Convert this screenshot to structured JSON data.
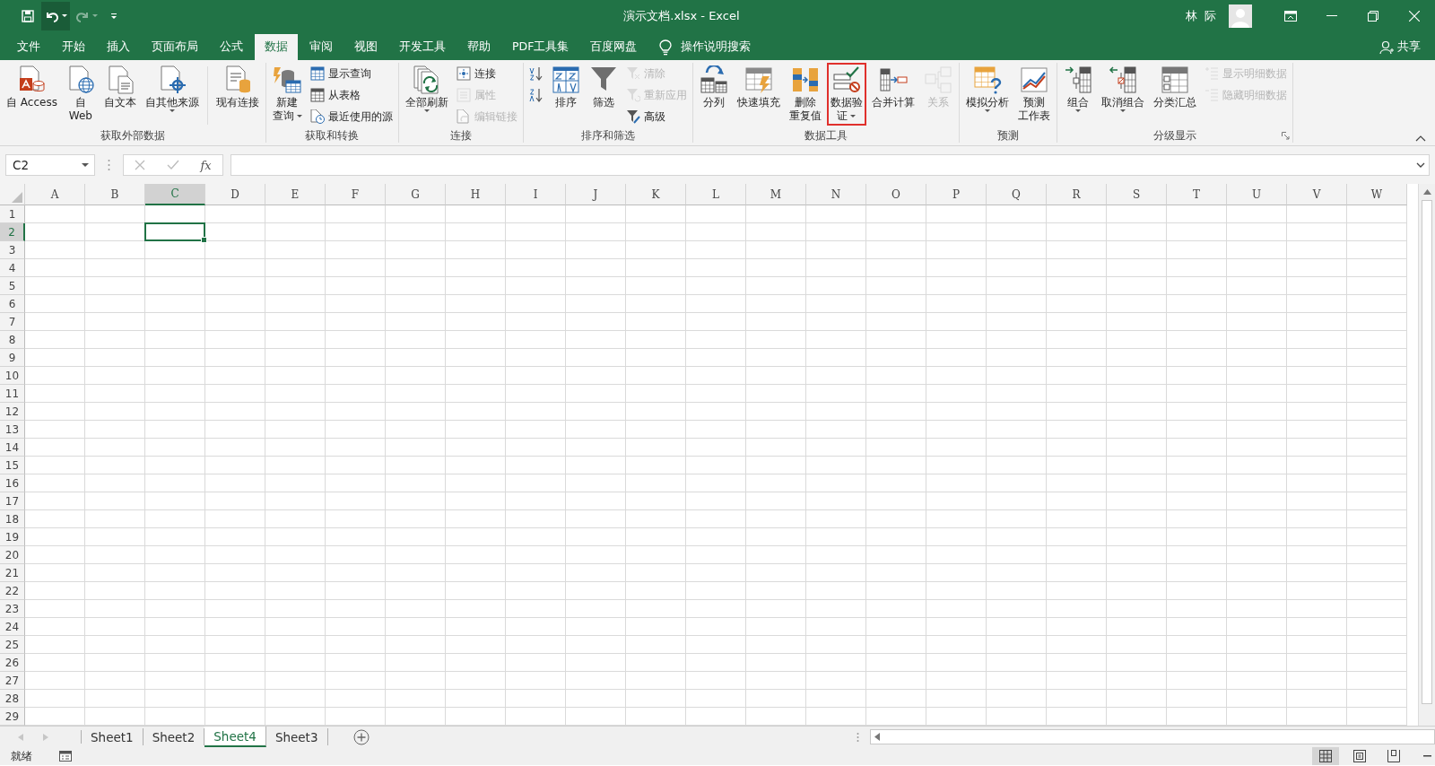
{
  "window": {
    "title": "演示文档.xlsx  -  Excel",
    "user": "林 际"
  },
  "quick_access": {
    "undo_active": true,
    "redo_disabled": true
  },
  "tabs": [
    {
      "label": "文件",
      "selected": false
    },
    {
      "label": "开始",
      "selected": false
    },
    {
      "label": "插入",
      "selected": false
    },
    {
      "label": "页面布局",
      "selected": false
    },
    {
      "label": "公式",
      "selected": false
    },
    {
      "label": "数据",
      "selected": true
    },
    {
      "label": "审阅",
      "selected": false
    },
    {
      "label": "视图",
      "selected": false
    },
    {
      "label": "开发工具",
      "selected": false
    },
    {
      "label": "帮助",
      "selected": false
    },
    {
      "label": "PDF工具集",
      "selected": false
    },
    {
      "label": "百度网盘",
      "selected": false
    }
  ],
  "tell_me": {
    "placeholder": "操作说明搜索"
  },
  "share": "共享",
  "ribbon_groups": [
    {
      "label": "获取外部数据",
      "items": [
        {
          "kind": "large",
          "lines": [
            "自 Access"
          ],
          "disabled": false,
          "dropdown": false,
          "highlighted": false
        },
        {
          "kind": "large",
          "lines": [
            "自",
            "Web"
          ],
          "disabled": false,
          "dropdown": false,
          "highlighted": false
        },
        {
          "kind": "large",
          "lines": [
            "自文本"
          ],
          "disabled": false,
          "dropdown": false,
          "highlighted": false
        },
        {
          "kind": "large",
          "lines": [
            "自其他来源"
          ],
          "disabled": false,
          "dropdown": true,
          "highlighted": false
        },
        {
          "kind": "separator"
        },
        {
          "kind": "large",
          "lines": [
            "现有连接"
          ],
          "disabled": false,
          "dropdown": false,
          "highlighted": false
        }
      ]
    },
    {
      "label": "获取和转换",
      "items": [
        {
          "kind": "large",
          "lines": [
            "新建",
            "查询"
          ],
          "disabled": false,
          "dropdown": true,
          "highlighted": false
        },
        {
          "kind": "stack",
          "buttons": [
            {
              "label": "显示查询",
              "disabled": false
            },
            {
              "label": "从表格",
              "disabled": false
            },
            {
              "label": "最近使用的源",
              "disabled": false
            }
          ]
        }
      ]
    },
    {
      "label": "连接",
      "items": [
        {
          "kind": "large",
          "lines": [
            "全部刷新"
          ],
          "disabled": false,
          "dropdown": true,
          "highlighted": false
        },
        {
          "kind": "stack",
          "buttons": [
            {
              "label": "连接",
              "disabled": false
            },
            {
              "label": "属性",
              "disabled": true
            },
            {
              "label": "编辑链接",
              "disabled": true
            }
          ]
        }
      ]
    },
    {
      "label": "排序和筛选",
      "items": [
        {
          "kind": "stack",
          "buttons": [
            {
              "disabled": false
            },
            {
              "disabled": false
            }
          ]
        },
        {
          "kind": "large",
          "lines": [
            "排序"
          ],
          "disabled": false,
          "dropdown": false,
          "highlighted": false
        },
        {
          "kind": "large",
          "lines": [
            "筛选"
          ],
          "disabled": false,
          "dropdown": false,
          "highlighted": false
        },
        {
          "kind": "stack",
          "buttons": [
            {
              "label": "清除",
              "disabled": true
            },
            {
              "label": "重新应用",
              "disabled": true
            },
            {
              "label": "高级",
              "disabled": false
            }
          ]
        }
      ]
    },
    {
      "label": "数据工具",
      "items": [
        {
          "kind": "large",
          "lines": [
            "分列"
          ],
          "disabled": false,
          "dropdown": false,
          "highlighted": false
        },
        {
          "kind": "large",
          "lines": [
            "快速填充"
          ],
          "disabled": false,
          "dropdown": false,
          "highlighted": false
        },
        {
          "kind": "large",
          "lines": [
            "删除",
            "重复值"
          ],
          "disabled": false,
          "dropdown": false,
          "highlighted": false
        },
        {
          "kind": "large",
          "lines": [
            "数据验",
            "证"
          ],
          "disabled": false,
          "dropdown": true,
          "highlighted": true
        },
        {
          "kind": "large",
          "lines": [
            "合并计算"
          ],
          "disabled": false,
          "dropdown": false,
          "highlighted": false
        },
        {
          "kind": "large",
          "lines": [
            "关系"
          ],
          "disabled": true,
          "dropdown": false,
          "highlighted": false
        }
      ]
    },
    {
      "label": "预测",
      "items": [
        {
          "kind": "large",
          "lines": [
            "模拟分析"
          ],
          "disabled": false,
          "dropdown": true,
          "highlighted": false
        },
        {
          "kind": "large",
          "lines": [
            "预测",
            "工作表"
          ],
          "disabled": false,
          "dropdown": false,
          "highlighted": false
        }
      ]
    },
    {
      "label": "分级显示",
      "launcher": true,
      "items": [
        {
          "kind": "large",
          "lines": [
            "组合"
          ],
          "disabled": false,
          "dropdown": true,
          "highlighted": false
        },
        {
          "kind": "large",
          "lines": [
            "取消组合"
          ],
          "disabled": false,
          "dropdown": true,
          "highlighted": false
        },
        {
          "kind": "large",
          "lines": [
            "分类汇总"
          ],
          "disabled": false,
          "dropdown": false,
          "highlighted": false
        },
        {
          "kind": "stack",
          "buttons": [
            {
              "label": "显示明细数据",
              "disabled": true
            },
            {
              "label": "隐藏明细数据",
              "disabled": true
            }
          ]
        }
      ]
    }
  ],
  "name_box": "C2",
  "formula": {
    "fx": "fx"
  },
  "columns": [
    {
      "label": "A",
      "selected": false
    },
    {
      "label": "B",
      "selected": false
    },
    {
      "label": "C",
      "selected": true
    },
    {
      "label": "D",
      "selected": false
    },
    {
      "label": "E",
      "selected": false
    },
    {
      "label": "F",
      "selected": false
    },
    {
      "label": "G",
      "selected": false
    },
    {
      "label": "H",
      "selected": false
    },
    {
      "label": "I",
      "selected": false
    },
    {
      "label": "J",
      "selected": false
    },
    {
      "label": "K",
      "selected": false
    },
    {
      "label": "L",
      "selected": false
    },
    {
      "label": "M",
      "selected": false
    },
    {
      "label": "N",
      "selected": false
    },
    {
      "label": "O",
      "selected": false
    },
    {
      "label": "P",
      "selected": false
    },
    {
      "label": "Q",
      "selected": false
    },
    {
      "label": "R",
      "selected": false
    },
    {
      "label": "S",
      "selected": false
    },
    {
      "label": "T",
      "selected": false
    },
    {
      "label": "U",
      "selected": false
    },
    {
      "label": "V",
      "selected": false
    },
    {
      "label": "W",
      "selected": false
    }
  ],
  "rows": [
    {
      "label": "1",
      "selected": false
    },
    {
      "label": "2",
      "selected": true
    },
    {
      "label": "3",
      "selected": false
    },
    {
      "label": "4",
      "selected": false
    },
    {
      "label": "5",
      "selected": false
    },
    {
      "label": "6",
      "selected": false
    },
    {
      "label": "7",
      "selected": false
    },
    {
      "label": "8",
      "selected": false
    },
    {
      "label": "9",
      "selected": false
    },
    {
      "label": "10",
      "selected": false
    },
    {
      "label": "11",
      "selected": false
    },
    {
      "label": "12",
      "selected": false
    },
    {
      "label": "13",
      "selected": false
    },
    {
      "label": "14",
      "selected": false
    },
    {
      "label": "15",
      "selected": false
    },
    {
      "label": "16",
      "selected": false
    },
    {
      "label": "17",
      "selected": false
    },
    {
      "label": "18",
      "selected": false
    },
    {
      "label": "19",
      "selected": false
    },
    {
      "label": "20",
      "selected": false
    },
    {
      "label": "21",
      "selected": false
    },
    {
      "label": "22",
      "selected": false
    },
    {
      "label": "23",
      "selected": false
    },
    {
      "label": "24",
      "selected": false
    },
    {
      "label": "25",
      "selected": false
    },
    {
      "label": "26",
      "selected": false
    },
    {
      "label": "27",
      "selected": false
    },
    {
      "label": "28",
      "selected": false
    },
    {
      "label": "29",
      "selected": false
    }
  ],
  "sheets": [
    {
      "label": "Sheet1",
      "selected": false
    },
    {
      "label": "Sheet2",
      "selected": false
    },
    {
      "label": "Sheet4",
      "selected": true
    },
    {
      "label": "Sheet3",
      "selected": false
    }
  ],
  "status_bar": {
    "text": "就绪",
    "views": [
      {
        "selected": true
      },
      {
        "selected": false
      },
      {
        "selected": false
      }
    ]
  }
}
